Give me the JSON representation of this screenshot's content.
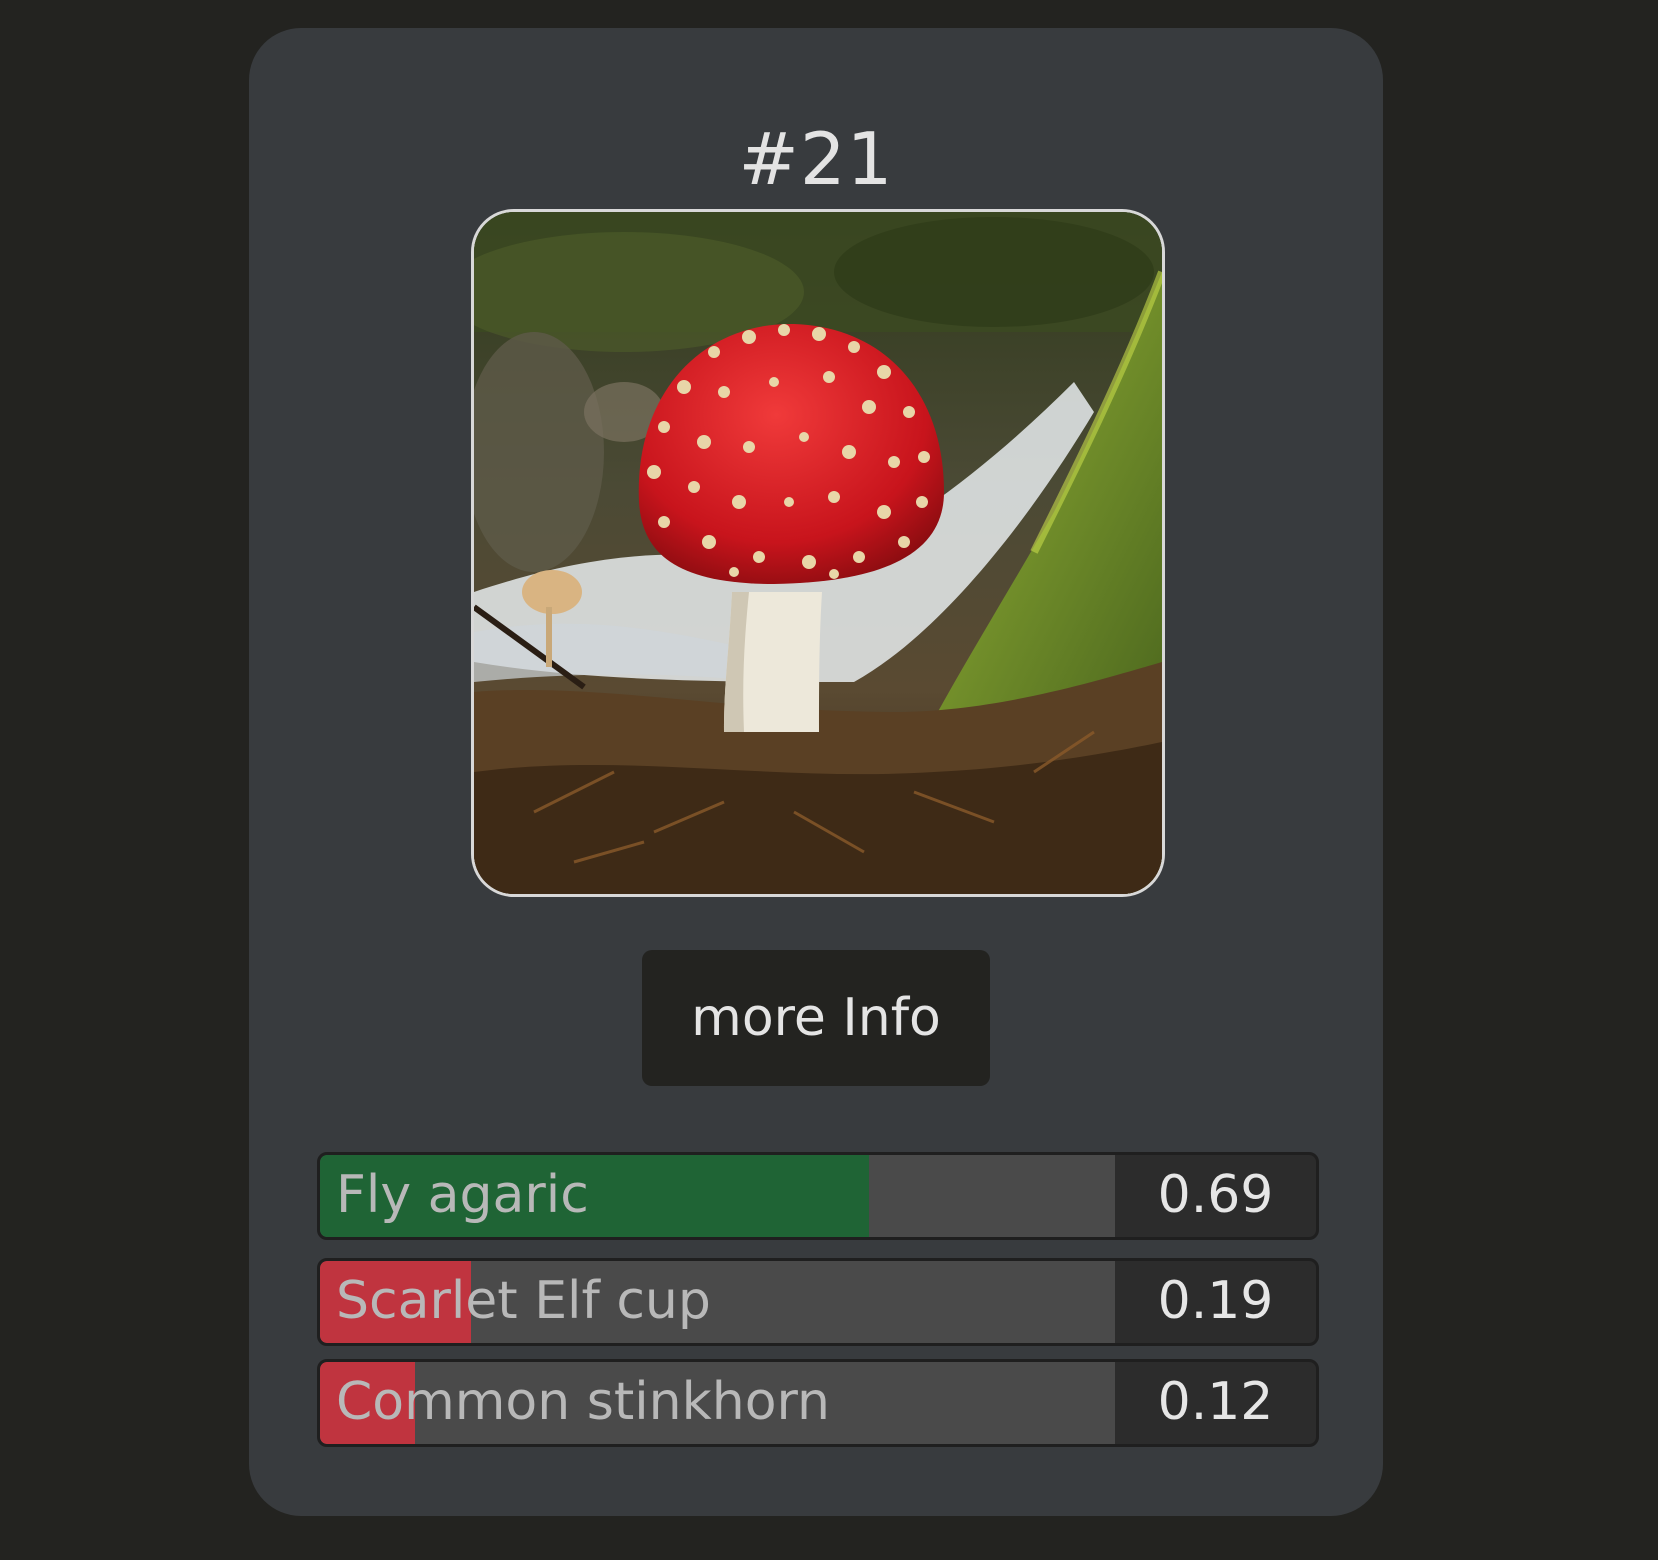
{
  "card": {
    "title": "#21",
    "button_label": "more Info"
  },
  "predictions": [
    {
      "label": "Fly agaric",
      "score": "0.69",
      "value": 0.69,
      "color": "#1f6435"
    },
    {
      "label": "Scarlet Elf cup",
      "score": "0.19",
      "value": 0.19,
      "color": "#c0343f"
    },
    {
      "label": "Common stinkhorn",
      "score": "0.12",
      "value": 0.12,
      "color": "#c0343f"
    }
  ],
  "colors": {
    "page_background": "#232320",
    "card_background": "#383b3e",
    "positive": "#1f6435",
    "negative": "#c0343f"
  }
}
